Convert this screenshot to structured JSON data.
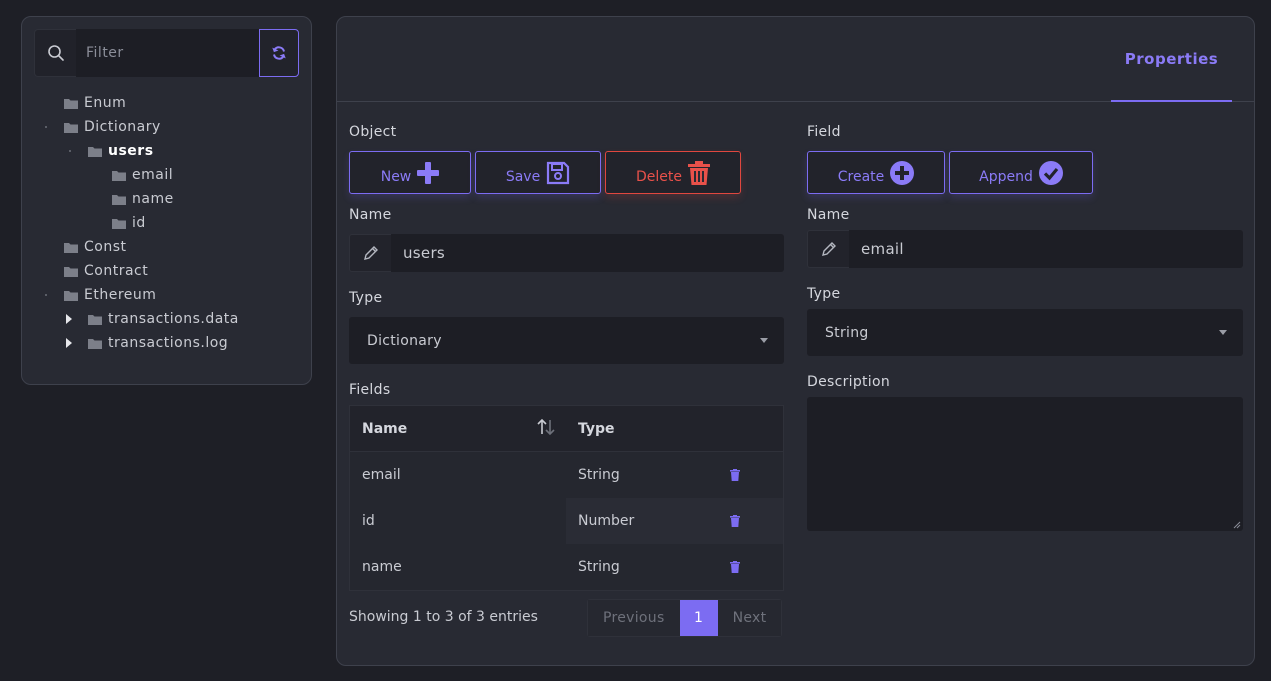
{
  "sidebar": {
    "filter_placeholder": "Filter",
    "tree": [
      {
        "label": "Enum"
      },
      {
        "label": "Dictionary"
      },
      {
        "label": "users"
      },
      {
        "label": "email"
      },
      {
        "label": "name"
      },
      {
        "label": "id"
      },
      {
        "label": "Const"
      },
      {
        "label": "Contract"
      },
      {
        "label": "Ethereum"
      },
      {
        "label": "transactions.data"
      },
      {
        "label": "transactions.log"
      }
    ]
  },
  "main": {
    "tab_label": "Properties",
    "object": {
      "section_label": "Object",
      "new_label": "New",
      "save_label": "Save",
      "delete_label": "Delete",
      "name_label": "Name",
      "name_value": "users",
      "type_label": "Type",
      "type_value": "Dictionary",
      "fields_label": "Fields",
      "table": {
        "headers": {
          "name": "Name",
          "type": "Type"
        },
        "rows": [
          {
            "name": "email",
            "type": "String"
          },
          {
            "name": "id",
            "type": "Number"
          },
          {
            "name": "name",
            "type": "String"
          }
        ]
      },
      "info": "Showing 1 to 3 of 3 entries",
      "pager": {
        "previous": "Previous",
        "page": "1",
        "next": "Next"
      }
    },
    "field": {
      "section_label": "Field",
      "create_label": "Create",
      "append_label": "Append",
      "name_label": "Name",
      "name_value": "email",
      "type_label": "Type",
      "type_value": "String",
      "description_label": "Description",
      "description_value": ""
    }
  },
  "colors": {
    "accent": "#7c6cf2",
    "danger": "#e0473f",
    "panel": "#282a33",
    "background": "#1e1f26"
  }
}
